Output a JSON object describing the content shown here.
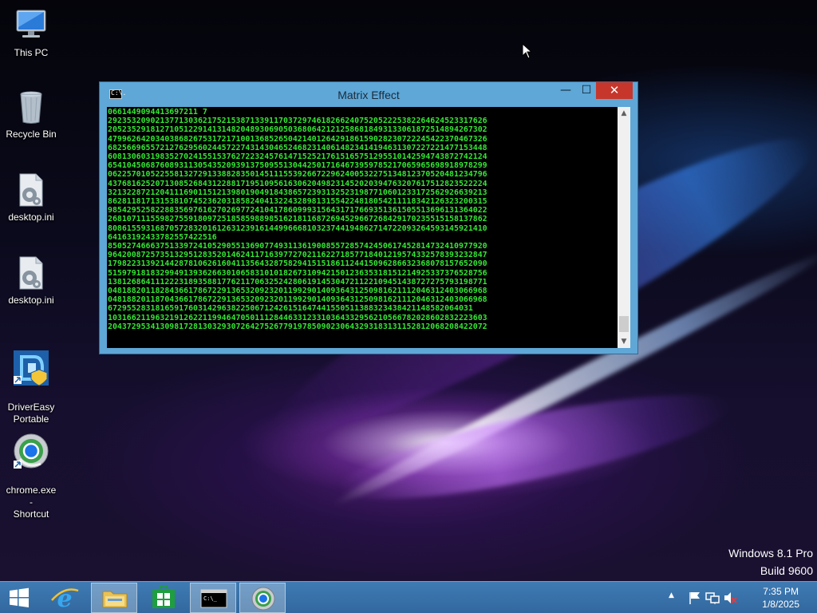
{
  "desktop": {
    "icons": [
      {
        "label": "This PC",
        "icon": "this-pc-icon"
      },
      {
        "label": "Recycle Bin",
        "icon": "recycle-bin-icon"
      },
      {
        "label": "desktop.ini",
        "icon": "settings-file-icon"
      },
      {
        "label": "desktop.ini",
        "icon": "settings-file-icon"
      },
      {
        "label": "DriverEasy\nPortable",
        "icon": "drivereasy-icon"
      },
      {
        "label": "chrome.exe -\nShortcut",
        "icon": "chrome-icon"
      }
    ],
    "watermark": {
      "line1": "Windows 8.1 Pro",
      "line2": "Build 9600"
    }
  },
  "window": {
    "title": "Matrix Effect",
    "icon": "console-icon",
    "icon_text": "C:\\.",
    "minimize_glyph": "—",
    "maximize_glyph": "☐",
    "close_glyph": "✕",
    "text_color": "#34e634",
    "console_lines": [
      "0661449094413697211 7",
      "29235320902137713036217521538713391170372974618266240752052225382264624523317626",
      "20523529181271051229141314820489306905036806421212586818493133061872514894267302",
      "47996264203403868267531721710013685265042140126429186159028230722245422370467326",
      "68256696557212762956024457227431430465246823140614823414194631307227221477153448",
      "60813060319835270241551537627223245761471525217615165751295510142594743872742124",
      "65410450687608931130543520939137509551304425017164673959785217065965698918978299",
      "06225701052255813272913388283501451115539266722962400532275134812370520481234796",
      "43768162520713085268431228817195109561630620498231452020394763207617512823522224",
      "32132287212041116901151213980190491843865723931325231987710601233172562926639213",
      "86281181713153810745236203185824041322432898131554224818054211118342126323200315",
      "98542952582288356976162702697724104178609993156431717669351361505513696131364022",
      "26810711155982755918097251858598898516218116872694529667268429170235515158137862",
      "80861559316870572832016126312391614499666810323744194862714722093264593145921410",
      "64163192433782557422516",
      "85052746663751339724105290551369077493113619008557285742450617452814732410977920",
      "96420087257351329512835201462411716397727021162271857718401219574332578393232847",
      "17982231392144287810626160411356432875829415151861124415096286632368078157652090",
      "51597918183299491393626630106583101018267310942150123635318151214925337376528756",
      "13812686411122231893588177621170632524280619145304721122109451438727275793198771",
      "04818820118284366178672291365320923201199290140936431250981621112046312403066968",
      "04818820118704366178672291365320923201199290140936431250981621112046312403066968",
      "67295528318165917603142963822506712426151647441550511388323438421148582064031",
      "10316621196321912622119946470501112844633123310364332956210566782028602832223603",
      "20437295341309817281303293072642752677919785090230643293183131152812068208422072"
    ]
  },
  "taskbar": {
    "start_icon": "windows-logo-icon",
    "items": [
      {
        "name": "internet-explorer",
        "icon": "ie-icon"
      },
      {
        "name": "file-explorer",
        "icon": "folder-icon"
      },
      {
        "name": "store",
        "icon": "store-icon"
      },
      {
        "name": "command-prompt",
        "icon": "console-icon"
      },
      {
        "name": "chrome",
        "icon": "chrome-icon"
      }
    ],
    "tray": {
      "chevron": "▲",
      "time": "7:35 PM",
      "date": "1/8/2025",
      "icons": [
        "flag-icon",
        "network-icon",
        "speaker-muted-icon"
      ]
    }
  }
}
